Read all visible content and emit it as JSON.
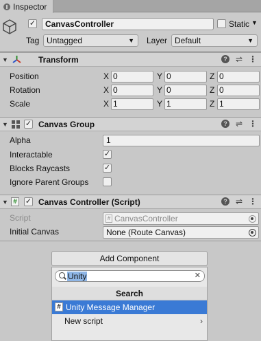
{
  "tab": {
    "label": "Inspector",
    "icon": "info-icon"
  },
  "header": {
    "object_name": "CanvasController",
    "active_checked": true,
    "static_label": "Static",
    "tag_label": "Tag",
    "tag_value": "Untagged",
    "layer_label": "Layer",
    "layer_value": "Default"
  },
  "transform": {
    "title": "Transform",
    "rows": [
      {
        "label": "Position",
        "x": "0",
        "y": "0",
        "z": "0"
      },
      {
        "label": "Rotation",
        "x": "0",
        "y": "0",
        "z": "0"
      },
      {
        "label": "Scale",
        "x": "1",
        "y": "1",
        "z": "1"
      }
    ],
    "axis": {
      "x": "X",
      "y": "Y",
      "z": "Z"
    }
  },
  "canvas_group": {
    "title": "Canvas Group",
    "enabled": true,
    "alpha_label": "Alpha",
    "alpha_value": "1",
    "interactable_label": "Interactable",
    "interactable": true,
    "blocks_label": "Blocks Raycasts",
    "blocks": true,
    "ignore_label": "Ignore Parent Groups",
    "ignore": false
  },
  "canvas_controller": {
    "title": "Canvas Controller (Script)",
    "enabled": true,
    "script_label": "Script",
    "script_value": "CanvasController",
    "initial_label": "Initial Canvas",
    "initial_value": "None (Route Canvas)"
  },
  "add_component": {
    "button_label": "Add Component",
    "search_query": "Unity",
    "popup_title": "Search",
    "items": [
      {
        "label": "Unity Message Manager",
        "selected": true
      },
      {
        "label": "New script",
        "selected": false
      }
    ]
  },
  "colors": {
    "selection": "#3a7ad5",
    "panel": "#c8c8c8"
  }
}
